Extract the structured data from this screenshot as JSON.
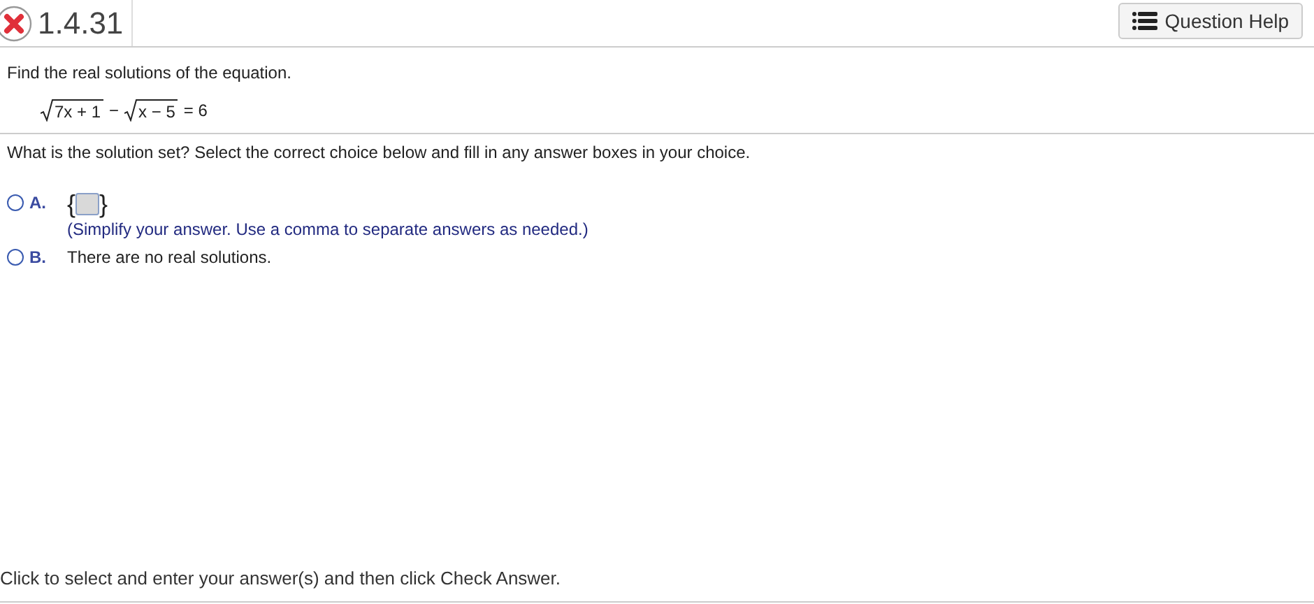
{
  "header": {
    "correct": false,
    "number": "1.4.31",
    "help_button": "Question Help"
  },
  "prompt": "Find the real solutions of the equation.",
  "equation": {
    "radicand_1": "7x + 1",
    "operator": "−",
    "radicand_2": "x − 5",
    "rhs": "= 6"
  },
  "question": "What is the solution set? Select the correct choice below and fill in any answer boxes in your choice.",
  "choices": [
    {
      "label": "A.",
      "kind": "set_answer",
      "selected": false,
      "open_brace": "{",
      "close_brace": "}",
      "hint": "(Simplify your answer. Use a comma to separate answers as needed.)"
    },
    {
      "label": "B.",
      "kind": "text",
      "selected": false,
      "text": "There are no real solutions."
    }
  ],
  "footer": "Click to select and enter your answer(s) and then click Check Answer."
}
